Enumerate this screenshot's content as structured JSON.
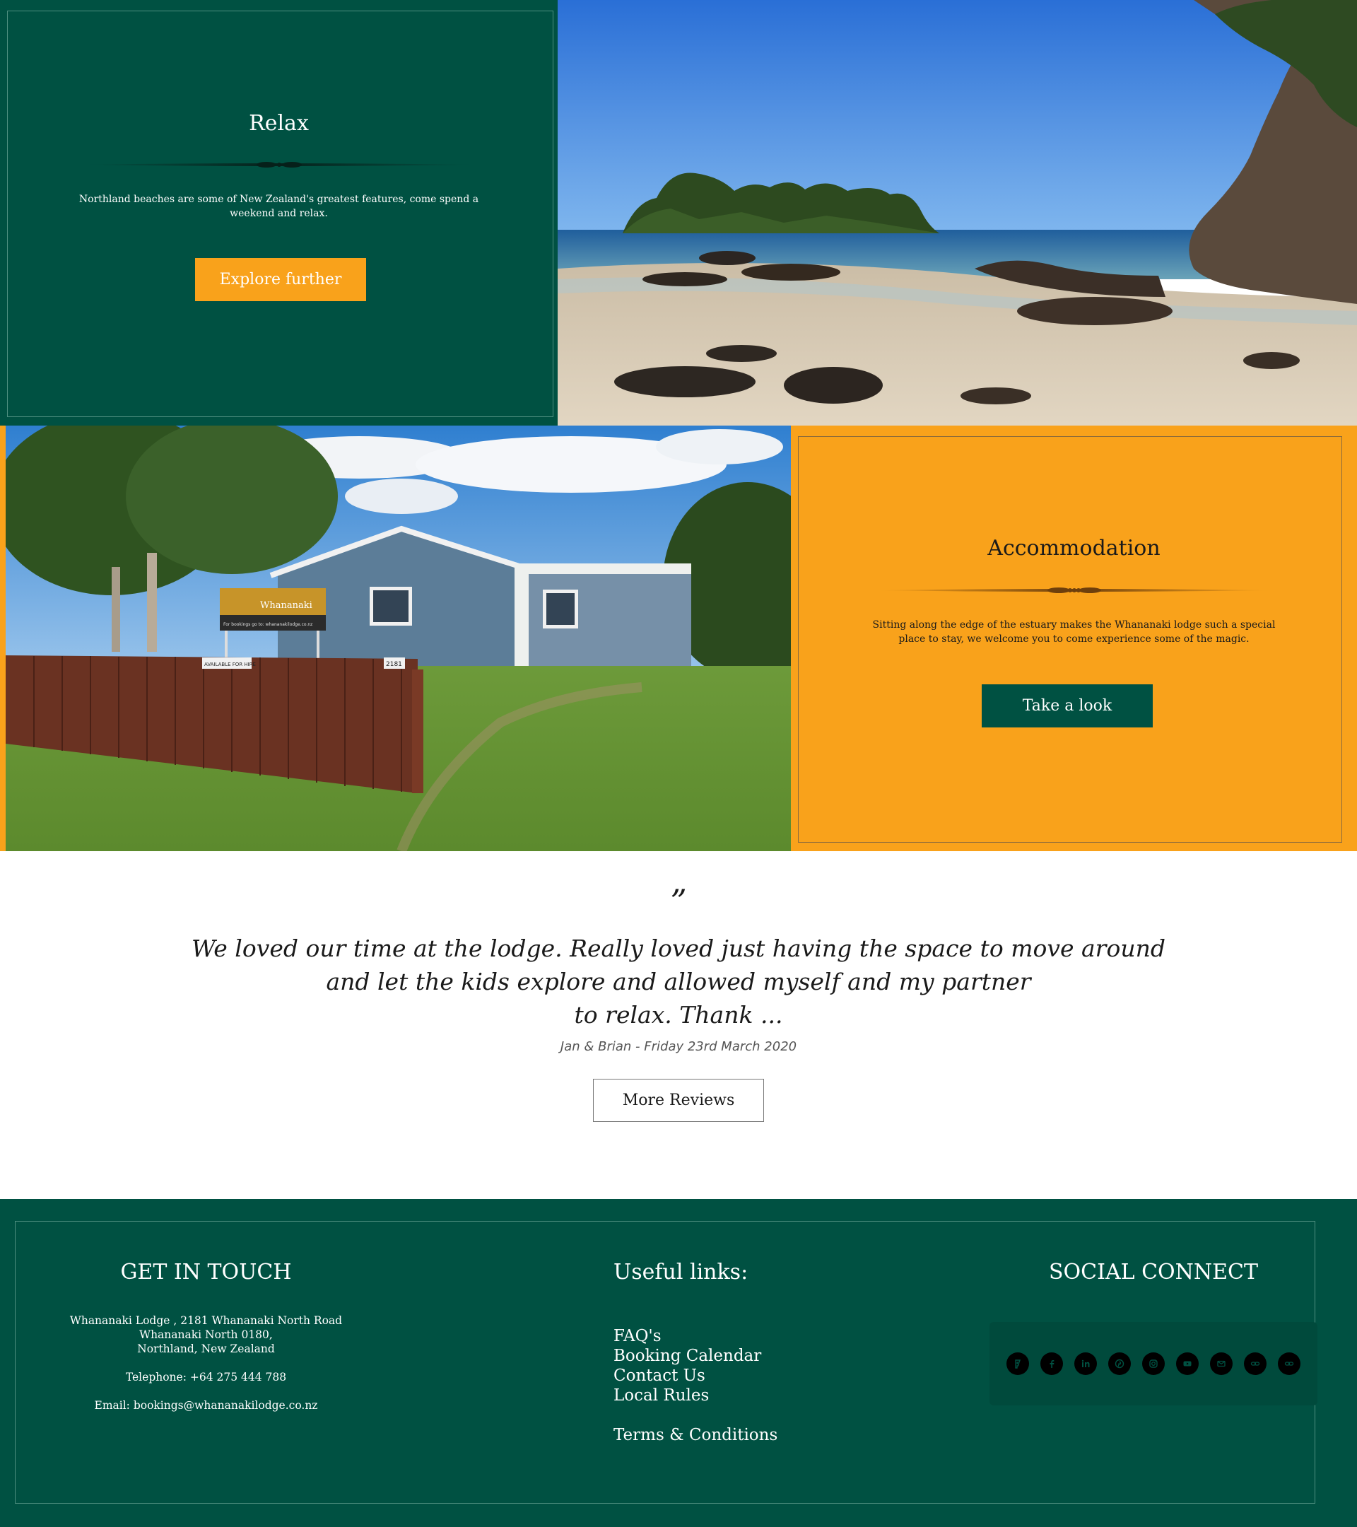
{
  "relax": {
    "title": "Relax",
    "text": "Northland beaches are some of New Zealand's greatest features, come spend a weekend and relax.",
    "button": "Explore further"
  },
  "accommodation": {
    "title": "Accommodation",
    "text": "Sitting along the edge of the estuary makes the Whananaki lodge such a special place to stay, we welcome you to come experience some of  the magic.",
    "button": "Take a look",
    "sign_name": "Whananaki",
    "sign_sub": "Lodge",
    "sign_booking": "For bookings go to: whananakilodge.co.nz",
    "hire_label": "AVAILABLE FOR HIRE",
    "street_number": "2181"
  },
  "testimonial": {
    "quote_mark": "”",
    "line1": "We loved our time at the lodge. Really loved just having the space to move around",
    "line2": "and let the kids explore and allowed myself and my partner",
    "line3": "to relax. Thank ...",
    "author": "Jan & Brian - Friday 23rd March 2020",
    "button": "More Reviews"
  },
  "footer": {
    "touch": {
      "heading": "GET IN TOUCH",
      "address1": "Whananaki Lodge , 2181 Whananaki North Road",
      "address2": "Whananaki North 0180,",
      "address3": "Northland, New Zealand",
      "telephone": "Telephone: +64 275 444 788",
      "email": "Email: bookings@whananakilodge.co.nz"
    },
    "links": {
      "heading": "Useful links:",
      "items": [
        "FAQ's",
        "Booking Calendar",
        "Contact Us",
        "Local Rules"
      ],
      "terms": "Terms & Conditions"
    },
    "social": {
      "heading": "SOCIAL CONNECT",
      "icons": [
        "foursquare-icon",
        "facebook-icon",
        "linkedin-icon",
        "pinterest-icon",
        "instagram-icon",
        "youtube-icon",
        "email-icon",
        "link-icon",
        "link-icon"
      ]
    }
  },
  "colors": {
    "green": "#005142",
    "orange": "#f9a21b",
    "white": "#ffffff"
  }
}
